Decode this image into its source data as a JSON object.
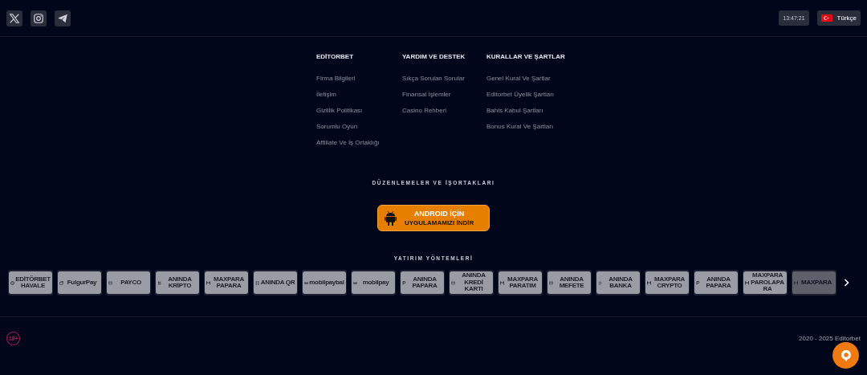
{
  "social": [
    {
      "kind": "x"
    },
    {
      "kind": "instagram"
    },
    {
      "kind": "telegram"
    }
  ],
  "clock": "13:47:21",
  "language": {
    "label": "Türkçe"
  },
  "link_columns": [
    {
      "heading": "EDİTORBET",
      "links": [
        "Firma Bilgileri",
        "İletişim",
        "Gizlilik Politikası",
        "Sorumlu Oyun",
        "Affiliate Ve İş Ortaklığı"
      ]
    },
    {
      "heading": "YARDIM VE DESTEK",
      "links": [
        "Sıkça Sorulan Sorular",
        "Finansal İşlemler",
        "Casino Rehberi"
      ]
    },
    {
      "heading": "KURALLAR VE ŞARTLAR",
      "links": [
        "Genel Kural Ve Şartlar",
        "Editorbet Üyelik Şartları",
        "Bahis Kabul Şartları",
        "Bonus Kural Ve Şartları"
      ]
    }
  ],
  "partners_title": "DÜZENLEMELER VE İŞORTAKLARI",
  "android_button": {
    "title": "ANDROID İÇİN",
    "subtitle": "UYGULAMAMIZI İNDİR"
  },
  "payments_title": "YATIRIM YÖNTEMLERİ",
  "payment_methods": [
    {
      "kind": "circle",
      "label": "EDİTÖRBET HAVALE"
    },
    {
      "kind": "wallet",
      "label": "FulgurPay"
    },
    {
      "kind": "card",
      "label": "PAYCO"
    },
    {
      "kind": "bitcoin",
      "label": "ANINDA KRİPTO"
    },
    {
      "kind": "m",
      "label": "MAXPARA PAPARA"
    },
    {
      "kind": "qr",
      "label": "ANINDA QR"
    },
    {
      "kind": "wm",
      "label": "mobilpaybal"
    },
    {
      "kind": "wm",
      "label": "mobilpay"
    },
    {
      "kind": "p",
      "label": "ANINDA PAPARA"
    },
    {
      "kind": "card",
      "label": "ANINDA KREDİ KARTI"
    },
    {
      "kind": "m",
      "label": "MAXPARA PARATIM"
    },
    {
      "kind": "card",
      "label": "ANINDA MEFETE"
    },
    {
      "kind": "swap",
      "label": "ANINDA BANKA"
    },
    {
      "kind": "m",
      "label": "MAXPARA CRYPTO"
    },
    {
      "kind": "p",
      "label": "ANINDA PAPARA"
    },
    {
      "kind": "m",
      "label": "MAXPARA PAROLAPARA"
    },
    {
      "kind": "m",
      "label": "MAXPARA"
    }
  ],
  "age_badge": "18+",
  "copyright": "2020 - 2025 Editorbet"
}
